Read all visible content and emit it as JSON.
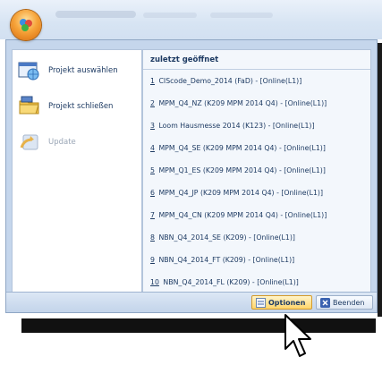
{
  "left_menu": {
    "items": [
      {
        "label": "Projekt auswählen",
        "enabled": true
      },
      {
        "label": "Projekt schließen",
        "enabled": true
      },
      {
        "label": "Update",
        "enabled": false
      }
    ]
  },
  "recent": {
    "header": "zuletzt geöffnet",
    "items": [
      {
        "num": "1",
        "text": "CIScode_Demo_2014 (FaD) - [Online(L1)]"
      },
      {
        "num": "2",
        "text": "MPM_Q4_NZ (K209 MPM 2014 Q4) - [Online(L1)]"
      },
      {
        "num": "3",
        "text": "Loom Hausmesse 2014 (K123) - [Online(L1)]"
      },
      {
        "num": "4",
        "text": "MPM_Q4_SE (K209 MPM 2014 Q4) - [Online(L1)]"
      },
      {
        "num": "5",
        "text": "MPM_Q1_ES (K209 MPM 2014 Q4) - [Online(L1)]"
      },
      {
        "num": "6",
        "text": "MPM_Q4_JP (K209 MPM 2014 Q4) - [Online(L1)]"
      },
      {
        "num": "7",
        "text": "MPM_Q4_CN (K209 MPM 2014 Q4) - [Online(L1)]"
      },
      {
        "num": "8",
        "text": "NBN_Q4_2014_SE (K209) - [Online(L1)]"
      },
      {
        "num": "9",
        "text": "NBN_Q4_2014_FT (K209) - [Online(L1)]"
      },
      {
        "num": "10",
        "text": "NBN_Q4_2014_FL (K209) - [Online(L1)]"
      }
    ]
  },
  "bottom_buttons": {
    "options_label": "Optionen",
    "exit_label": "Beenden"
  }
}
